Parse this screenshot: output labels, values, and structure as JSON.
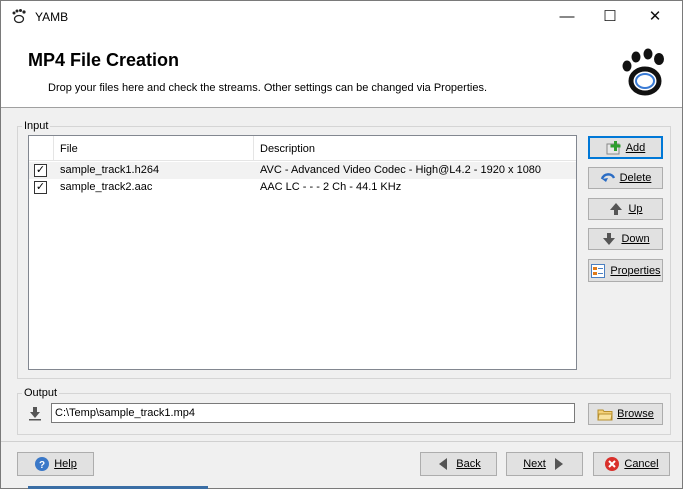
{
  "window": {
    "title": "YAMB",
    "controls": {
      "minimize": "—",
      "maximize": "☐",
      "close": "✕"
    }
  },
  "header": {
    "title": "MP4 File Creation",
    "subtitle": "Drop your files here and check the streams. Other settings can be changed via Properties."
  },
  "input": {
    "group_label": "Input",
    "columns": [
      "File",
      "Description"
    ],
    "rows": [
      {
        "checked": true,
        "file": "sample_track1.h264",
        "description": "AVC - Advanced Video Codec - High@L4.2 - 1920 x 1080"
      },
      {
        "checked": true,
        "file": "sample_track2.aac",
        "description": "AAC LC -  -  - 2 Ch - 44.1 KHz"
      }
    ],
    "buttons": {
      "add": "Add",
      "delete": "Delete",
      "up": "Up",
      "down": "Down",
      "properties": "Properties"
    }
  },
  "output": {
    "group_label": "Output",
    "path": "C:\\Temp\\sample_track1.mp4",
    "browse": "Browse"
  },
  "footer": {
    "help": "Help",
    "back": "Back",
    "next": "Next",
    "cancel": "Cancel"
  },
  "colors": {
    "accent": "#0078d7",
    "dialog_bg": "#f0f0f0",
    "button_bg": "#e1e1e1"
  }
}
